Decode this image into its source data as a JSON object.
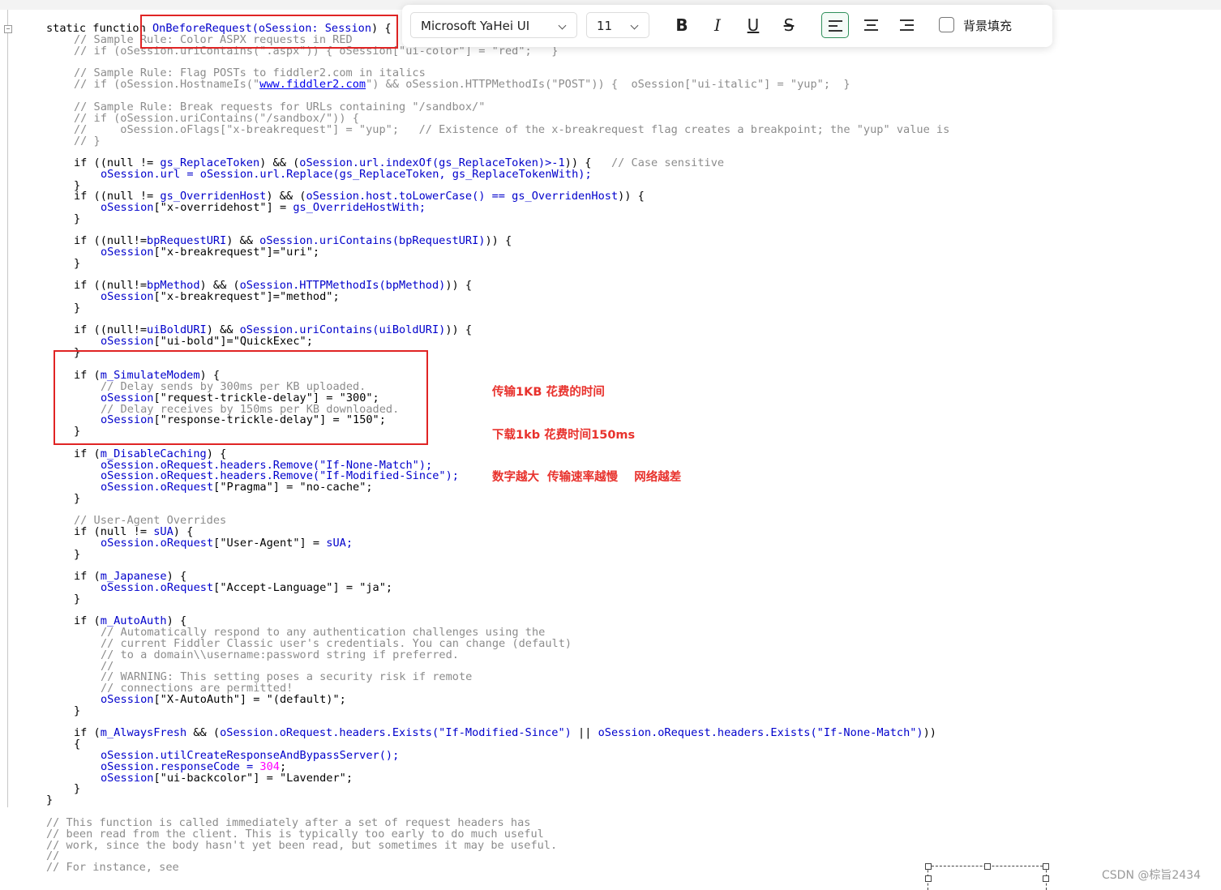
{
  "toolbar": {
    "font_family": "Microsoft YaHei UI",
    "font_size": "11",
    "bold_icon": "B",
    "italic_icon": "I",
    "underline_icon": "U",
    "strike_icon": "S",
    "bg_fill_label": "背景填充"
  },
  "code": {
    "l1": {
      "a": "static function ",
      "b": "OnBeforeRequest",
      "c": "(",
      "d": "oSession: Session",
      ")": "",
      "e": ") {"
    },
    "l2": "// Sample Rule: Color ASPX requests in RED",
    "l3": "// if (oSession.uriContains(\".aspx\")) { oSession[\"ui-color\"] = \"red\";   }",
    "l4": "// Sample Rule: Flag POSTs to fiddler2.com in italics",
    "l5a": "// if (oSession.HostnameIs(\"",
    "l5link": "www.fiddler2.com",
    "l5b": "\") && oSession.HTTPMethodIs(\"POST\")) {  oSession[\"ui-italic\"] = \"yup\";  }",
    "l6": "// Sample Rule: Break requests for URLs containing \"/sandbox/\"",
    "l7": "// if (oSession.uriContains(\"/sandbox/\")) {",
    "l8": "//     oSession.oFlags[\"x-breakrequest\"] = \"yup\";   // Existence of the x-breakrequest flag creates a breakpoint; the \"yup\" value is",
    "l9": "// }",
    "l10a": "if ((null != ",
    "l10b": "gs_ReplaceToken",
    "l10c": ") && (",
    "l10d": "oSession.url.indexOf(gs_ReplaceToken)>-1",
    "l10e": ")) {   ",
    "l10f": "// Case sensitive",
    "l11": "oSession.url = oSession.url.Replace(gs_ReplaceToken, gs_ReplaceTokenWith);",
    "l12": "}",
    "l13a": "if ((null != ",
    "l13b": "gs_OverridenHost",
    "l13c": ") && (",
    "l13d": "oSession.host.toLowerCase() == gs_OverridenHost",
    "l13e": ")) {",
    "l14a": "oSession",
    "l14b": "[\"x-overridehost\"] = ",
    "l14c": "gs_OverrideHostWith;",
    "l15": "}",
    "l16a": "if ((null!=",
    "l16b": "bpRequestURI",
    "l16c": ") && ",
    "l16d": "oSession.uriContains(bpRequestURI)",
    "l16e": ")) {",
    "l17a": "oSession",
    "l17b": "[\"x-breakrequest\"]=\"uri\";",
    "l18": "}",
    "l19a": "if ((null!=",
    "l19b": "bpMethod",
    "l19c": ") && (",
    "l19d": "oSession.HTTPMethodIs(bpMethod)",
    "l19e": ")) {",
    "l20a": "oSession",
    "l20b": "[\"x-breakrequest\"]=\"method\";",
    "l21": "}",
    "l22a": "if ((null!=",
    "l22b": "uiBoldURI",
    "l22c": ") && ",
    "l22d": "oSession.uriContains(uiBoldURI)",
    "l22e": ")) {",
    "l23a": "oSession",
    "l23b": "[\"ui-bold\"]=\"QuickExec\";",
    "l24": "}",
    "l25a": "if (",
    "l25b": "m_SimulateModem",
    "l25c": ") {",
    "l26": "// Delay sends by 300ms per KB uploaded.",
    "l27a": "oSession",
    "l27b": "[\"request-trickle-delay\"] = \"300\";",
    "l28": "// Delay receives by 150ms per KB downloaded.",
    "l29a": "oSession",
    "l29b": "[\"response-trickle-delay\"] = \"150\";",
    "l30": "}",
    "l31a": "if (",
    "l31b": "m_DisableCaching",
    "l31c": ") {",
    "l32": "oSession.oRequest.headers.Remove(\"If-None-Match\");",
    "l33": "oSession.oRequest.headers.Remove(\"If-Modified-Since\");",
    "l34a": "oSession.oRequest",
    "l34b": "[\"Pragma\"] = \"no-cache\";",
    "l35": "}",
    "l36": "// User-Agent Overrides",
    "l37a": "if (null != ",
    "l37b": "sUA",
    "l37c": ") {",
    "l38a": "oSession.oRequest",
    "l38b": "[\"User-Agent\"] = ",
    "l38c": "sUA;",
    "l39": "}",
    "l40a": "if (",
    "l40b": "m_Japanese",
    "l40c": ") {",
    "l41a": "oSession.oRequest",
    "l41b": "[\"Accept-Language\"] = \"ja\";",
    "l42": "}",
    "l43a": "if (",
    "l43b": "m_AutoAuth",
    "l43c": ") {",
    "l44": "// Automatically respond to any authentication challenges using the",
    "l45": "// current Fiddler Classic user's credentials. You can change (default)",
    "l46": "// to a domain\\\\username:password string if preferred.",
    "l47": "//",
    "l48": "// WARNING: This setting poses a security risk if remote",
    "l49": "// connections are permitted!",
    "l50a": "oSession",
    "l50b": "[\"X-AutoAuth\"] = \"(default)\";",
    "l51": "}",
    "l52a": "if (",
    "l52b": "m_AlwaysFresh",
    "l52c": " && (",
    "l52d": "oSession.oRequest.headers.Exists(\"If-Modified-Since\")",
    "l52e": " || ",
    "l52f": "oSession.oRequest.headers.Exists(\"If-None-Match\")",
    "l52g": "))",
    "l53": "{",
    "l54": "oSession.utilCreateResponseAndBypassServer();",
    "l55a": "oSession.responseCode = ",
    "l55b": "304",
    "l55c": ";",
    "l56a": "oSession",
    "l56b": "[\"ui-backcolor\"] = \"Lavender\";",
    "l57": "}",
    "l58": "}",
    "l59": "// This function is called immediately after a set of request headers has",
    "l60": "// been read from the client. This is typically too early to do much useful",
    "l61": "// work, since the body hasn't yet been read, but sometimes it may be useful.",
    "l62": "//",
    "l63": "// For instance, see"
  },
  "annotations": {
    "upload": "传输1KB 花费的时间",
    "download": "下载1kb 花费时间150ms",
    "slower": "数字越大  传输速率越慢    网络越差"
  },
  "watermark": "CSDN @棕旨2434",
  "colors": {
    "accent_red": "#e02424",
    "active_green": "#2f8f5a",
    "code_blue": "#0000cc",
    "comment_gray": "#8c8c8c"
  }
}
